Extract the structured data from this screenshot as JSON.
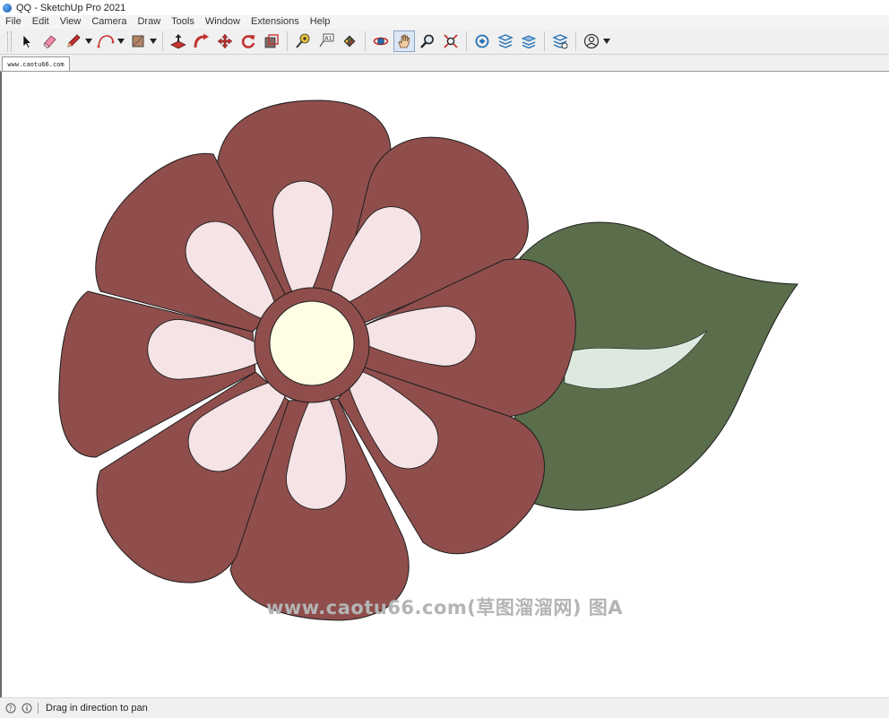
{
  "window": {
    "title": "QQ - SketchUp Pro 2021"
  },
  "menu": [
    "File",
    "Edit",
    "View",
    "Camera",
    "Draw",
    "Tools",
    "Window",
    "Extensions",
    "Help"
  ],
  "toolbar": {
    "tools": [
      {
        "name": "select-tool",
        "icon": "arrow-cursor-icon"
      },
      {
        "name": "eraser-tool",
        "icon": "eraser-icon"
      },
      {
        "name": "line-tool",
        "icon": "pencil-icon"
      },
      {
        "name": "arc-tool",
        "icon": "arc-icon"
      },
      {
        "name": "shapes-tool",
        "icon": "rectangle-icon"
      },
      {
        "name": "push-pull-tool",
        "icon": "push-pull-icon"
      },
      {
        "name": "follow-me-tool",
        "icon": "follow-me-icon"
      },
      {
        "name": "move-tool",
        "icon": "move-icon"
      },
      {
        "name": "rotate-tool",
        "icon": "rotate-icon"
      },
      {
        "name": "scale-tool",
        "icon": "scale-icon"
      },
      {
        "name": "tape-measure-tool",
        "icon": "tape-measure-icon"
      },
      {
        "name": "text-tool",
        "icon": "text-icon"
      },
      {
        "name": "paint-bucket-tool",
        "icon": "paint-bucket-icon"
      },
      {
        "name": "orbit-tool",
        "icon": "orbit-icon"
      },
      {
        "name": "pan-tool",
        "icon": "hand-icon",
        "active": true
      },
      {
        "name": "zoom-tool",
        "icon": "magnifier-icon"
      },
      {
        "name": "zoom-extents-tool",
        "icon": "zoom-extents-icon"
      },
      {
        "name": "3d-warehouse-button",
        "icon": "warehouse-icon"
      },
      {
        "name": "extension-warehouse-button",
        "icon": "extension-warehouse-icon"
      },
      {
        "name": "layout-button",
        "icon": "layout-icon"
      },
      {
        "name": "extension-manager-button",
        "icon": "extension-manager-icon"
      },
      {
        "name": "account-button",
        "icon": "user-icon"
      }
    ]
  },
  "scene_tab": {
    "label": "www.caotu66.com"
  },
  "colors": {
    "petal": "#8f4e4c",
    "petal_inner": "#f5e3e6",
    "center_ring": "#8f4e4c",
    "center": "#fffde4",
    "leaf": "#5a6e4b",
    "leaf_vein": "#dde9df",
    "outline": "#1e1e1e"
  },
  "watermark": {
    "text": "www.caotu66.com(草图溜溜网) 图A"
  },
  "status": {
    "text": "Drag in direction to pan"
  }
}
